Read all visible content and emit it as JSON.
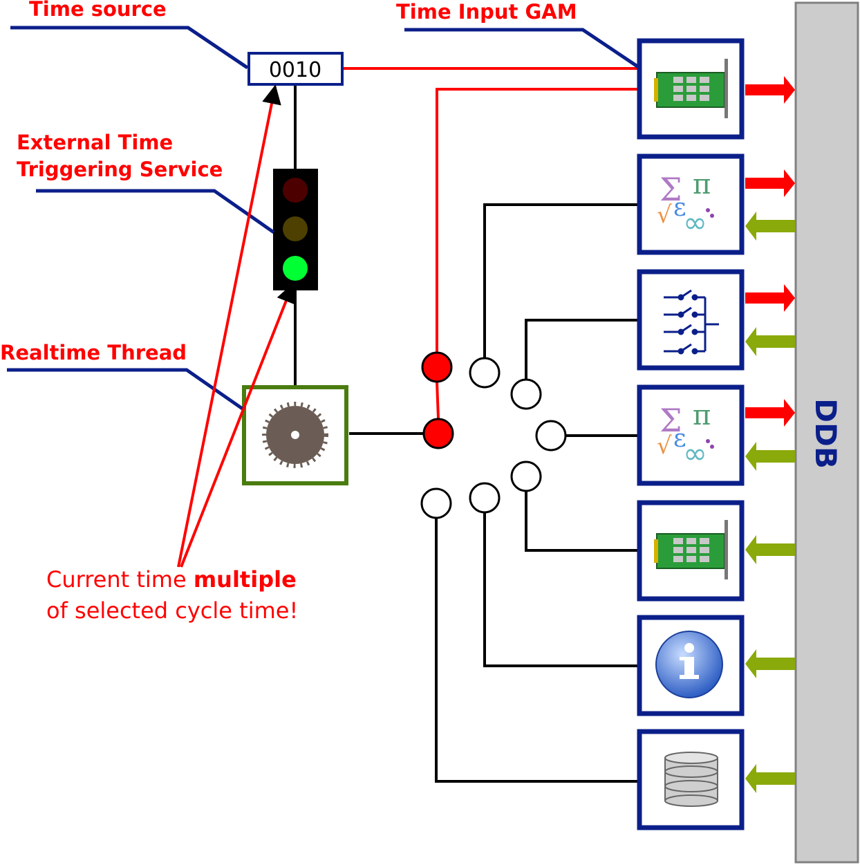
{
  "labels": {
    "time_source": "Time source",
    "time_input_gam": "Time Input GAM",
    "external_time_line1": "External Time",
    "external_time_line2": "Triggering Service",
    "realtime_thread": "Realtime Thread",
    "note_line1_a": "Current time ",
    "note_line1_b": "multiple",
    "note_line2": "of selected cycle time!"
  },
  "counter_value": "0010",
  "ddb_label": "DDB",
  "gams": [
    {
      "icon": "pci-card-icon",
      "output": true,
      "input": false
    },
    {
      "icon": "math-formula-icon",
      "output": true,
      "input": true
    },
    {
      "icon": "switch-logic-icon",
      "output": true,
      "input": true
    },
    {
      "icon": "math-formula-icon",
      "output": true,
      "input": true
    },
    {
      "icon": "pci-card-icon",
      "output": false,
      "input": true
    },
    {
      "icon": "info-icon",
      "output": false,
      "input": true
    },
    {
      "icon": "database-icon",
      "output": false,
      "input": true
    }
  ],
  "colors": {
    "label_red": "#ff0000",
    "leader_blue": "#0b1f8a",
    "box_blue": "#0b1f8a",
    "thread_green": "#4a7c10",
    "output_arrow": "#ff0000",
    "input_arrow": "#8aa90a",
    "ddb_fill": "#cccccc"
  }
}
